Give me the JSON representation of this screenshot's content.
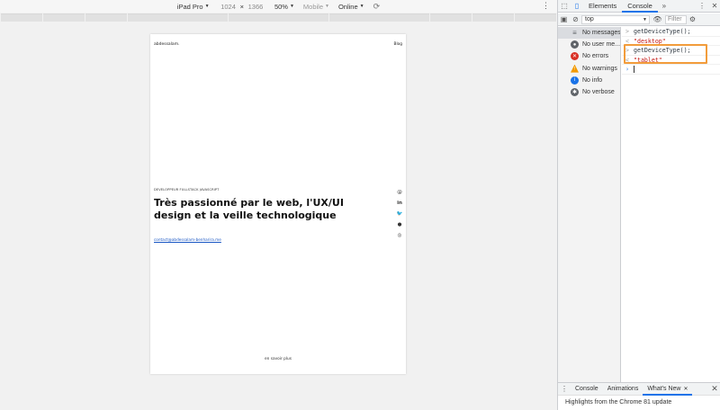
{
  "emulation": {
    "device": "iPad Pro",
    "width": "1024",
    "times": "×",
    "height": "1366",
    "zoom": "50%",
    "throttle_mode": "Mobile",
    "network": "Online"
  },
  "site": {
    "logo": "abdessalam.",
    "nav_blog": "Blog",
    "subtitle": "DEVELOPPEUR FULLSTACK JAVASCRIPT",
    "headline": "Très passionné par le web, l'UX/UI design et la veille technologique",
    "email": "contact@abdessalam-benharira.me",
    "more_link": "en savoir plus"
  },
  "devtools": {
    "tabs": [
      "Elements",
      "Console"
    ],
    "active_tab": "Console",
    "context": "top",
    "filter_placeholder": "Filter",
    "sidebar": [
      {
        "label": "No messages",
        "icon": "list-icon",
        "color": "#5f6368"
      },
      {
        "label": "No user me...",
        "icon": "user-icon",
        "color": "#5f6368"
      },
      {
        "label": "No errors",
        "icon": "error-icon",
        "color": "#d93025"
      },
      {
        "label": "No warnings",
        "icon": "warning-icon",
        "color": "#f29900"
      },
      {
        "label": "No info",
        "icon": "info-icon",
        "color": "#1a73e8"
      },
      {
        "label": "No verbose",
        "icon": "verbose-icon",
        "color": "#5f6368"
      }
    ],
    "console_lines": [
      {
        "prompt": ">",
        "text": "getDeviceType();",
        "kind": "input"
      },
      {
        "prompt": "<",
        "text": "\"desktop\"",
        "kind": "output"
      },
      {
        "prompt": ">",
        "text": "getDeviceType();",
        "kind": "input"
      },
      {
        "prompt": "<",
        "text": "\"tablet\"",
        "kind": "output"
      }
    ],
    "drawer_tabs": [
      "Console",
      "Animations",
      "What's New"
    ],
    "drawer_active": "What's New",
    "drawer_content": "Highlights from the Chrome 81 update"
  }
}
